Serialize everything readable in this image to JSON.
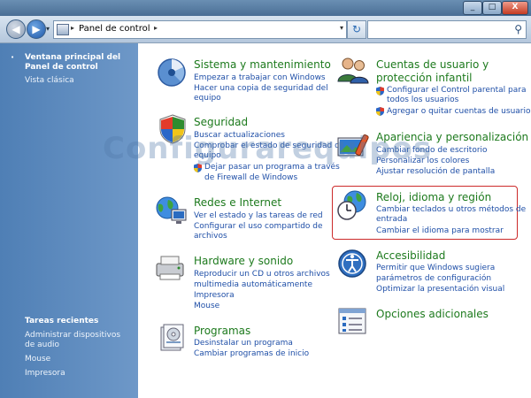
{
  "window": {
    "minimize": "_",
    "maximize": "□",
    "close": "X"
  },
  "nav": {
    "back": "◀",
    "forward": "▶",
    "dropdown": "▾",
    "breadcrumb_arrow": "▸",
    "address": "Panel de control",
    "address_arrow": "▸",
    "address_dropdown": "▾",
    "refresh": "↻",
    "search_icon": "⚲",
    "search_placeholder": ""
  },
  "sidebar": {
    "bullet": "•",
    "active_item": "Ventana principal del Panel de control",
    "classic_view": "Vista clásica",
    "recent_heading": "Tareas recientes",
    "recent": [
      "Administrar dispositivos de audio",
      "Mouse",
      "Impresora"
    ]
  },
  "watermark": "Configurarequipos",
  "categories": {
    "sistema": {
      "title": "Sistema y mantenimiento",
      "links": [
        "Empezar a trabajar con Windows",
        "Hacer una copia de seguridad del",
        "equipo"
      ]
    },
    "seguridad": {
      "title": "Seguridad",
      "links": [
        "Buscar actualizaciones",
        "Comprobar el estado de seguridad del",
        "equipo",
        "Dejar pasar un programa a través",
        "de Firewall de Windows"
      ]
    },
    "redes": {
      "title": "Redes e Internet",
      "links": [
        "Ver el estado y las tareas de red",
        "Configurar el uso compartido de",
        "archivos"
      ]
    },
    "hardware": {
      "title": "Hardware y sonido",
      "links": [
        "Reproducir un CD u otros archivos",
        "multimedia automáticamente",
        "Impresora",
        "Mouse"
      ]
    },
    "programas": {
      "title": "Programas",
      "links": [
        "Desinstalar un programa",
        "Cambiar programas de inicio"
      ]
    },
    "cuentas": {
      "title_line1": "Cuentas de usuario y",
      "title_line2": "protección infantil",
      "links": [
        "Configurar el Control parental para",
        "todos los usuarios",
        "Agregar o quitar cuentas de usuario"
      ]
    },
    "apariencia": {
      "title": "Apariencia y personalización",
      "links": [
        "Cambiar fondo de escritorio",
        "Personalizar los colores",
        "Ajustar resolución de pantalla"
      ]
    },
    "reloj": {
      "title": "Reloj, idioma y región",
      "links": [
        "Cambiar teclados u otros métodos de",
        "entrada",
        "Cambiar el idioma para mostrar"
      ]
    },
    "accesibilidad": {
      "title": "Accesibilidad",
      "links": [
        "Permitir que Windows sugiera",
        "parámetros de configuración",
        "Optimizar la presentación visual"
      ]
    },
    "opciones": {
      "title": "Opciones adicionales"
    }
  }
}
